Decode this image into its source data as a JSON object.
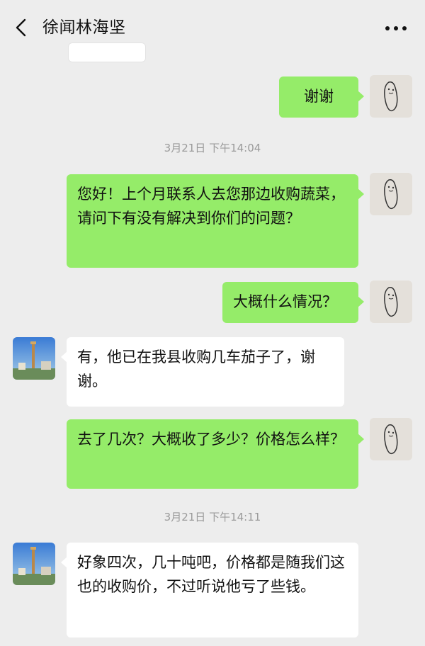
{
  "header": {
    "title": "徐闻林海坚",
    "back_icon": "chevron-left-icon",
    "more_icon": "ellipsis-icon"
  },
  "colors": {
    "background": "#ededed",
    "my_bubble": "#95ec69",
    "their_bubble": "#ffffff"
  },
  "chat": {
    "msg1": "谢谢",
    "time1": "3月21日 下午14:04",
    "msg2": "您好！上个月联系人去您那边收购蔬菜，请问下有没有解决到你们的问题？",
    "msg3": "大概什么情况？",
    "msg4": "有，他已在我县收购几车茄子了，谢谢。",
    "msg5": "去了几次？大概收了多少？价格怎么样？",
    "time2": "3月21日 下午14:11",
    "msg6": "好象四次，几十吨吧，价格都是随我们这也的收购价，不过听说他亏了些钱。"
  }
}
